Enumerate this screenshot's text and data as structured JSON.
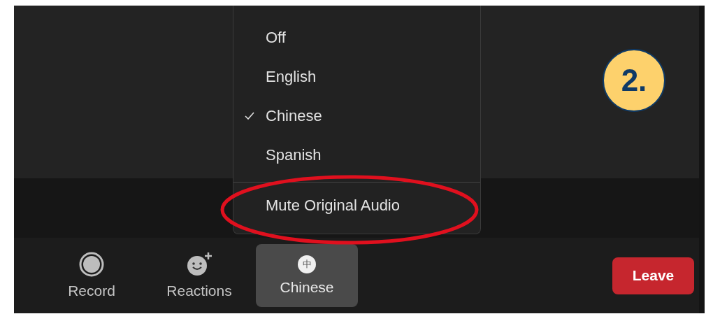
{
  "menu": {
    "items": [
      {
        "label": "Off",
        "selected": false
      },
      {
        "label": "English",
        "selected": false
      },
      {
        "label": "Chinese",
        "selected": true
      },
      {
        "label": "Spanish",
        "selected": false
      }
    ],
    "action": "Mute Original Audio",
    "highlighted": true
  },
  "toolbar": [
    {
      "kind": "record",
      "label": "Record",
      "selected": false
    },
    {
      "kind": "reactions",
      "label": "Reactions",
      "selected": false
    },
    {
      "kind": "language",
      "label": "Chinese",
      "icon_glyph": "中",
      "selected": true
    }
  ],
  "leave_button": "Leave",
  "step_badge": "2."
}
